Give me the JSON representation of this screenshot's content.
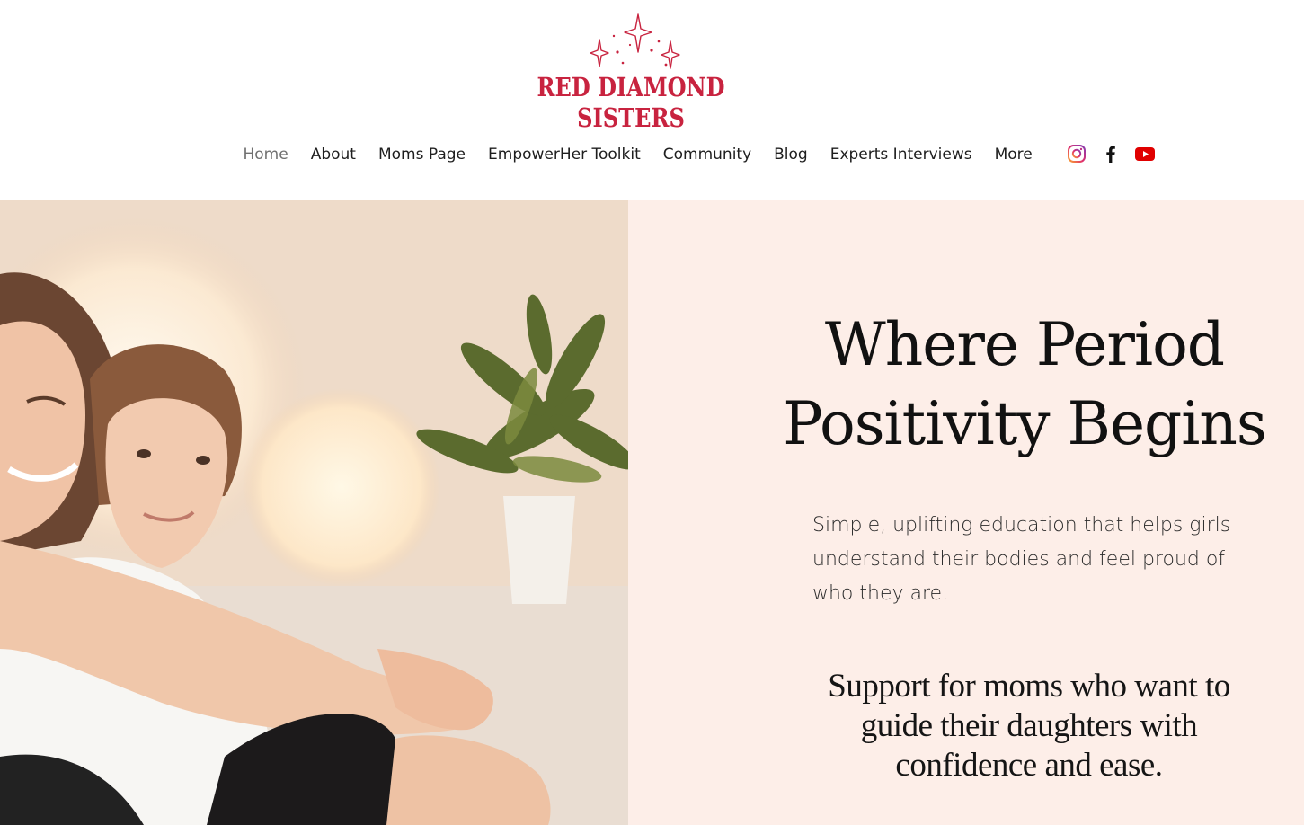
{
  "brand": {
    "name": "RED DIAMOND SISTERS",
    "color": "#c8233f"
  },
  "nav": {
    "items": [
      {
        "label": "Home",
        "active": true
      },
      {
        "label": "About"
      },
      {
        "label": "Moms Page"
      },
      {
        "label": "EmpowerHer Toolkit"
      },
      {
        "label": "Community"
      },
      {
        "label": "Blog"
      },
      {
        "label": "Experts Interviews"
      },
      {
        "label": "More"
      }
    ]
  },
  "social": {
    "icons": [
      "instagram-icon",
      "facebook-icon",
      "youtube-icon"
    ]
  },
  "hero": {
    "photo": "mother-and-daughter-hugging-photo",
    "panel_color": "#fdeee8",
    "headline_line1": "Where Period",
    "headline_line2": "Positivity Begins",
    "lead": "Simple, uplifting education that helps girls understand their bodies and feel proud of who they are.",
    "support": "Support for moms who want to guide their daughters with confidence and ease."
  }
}
